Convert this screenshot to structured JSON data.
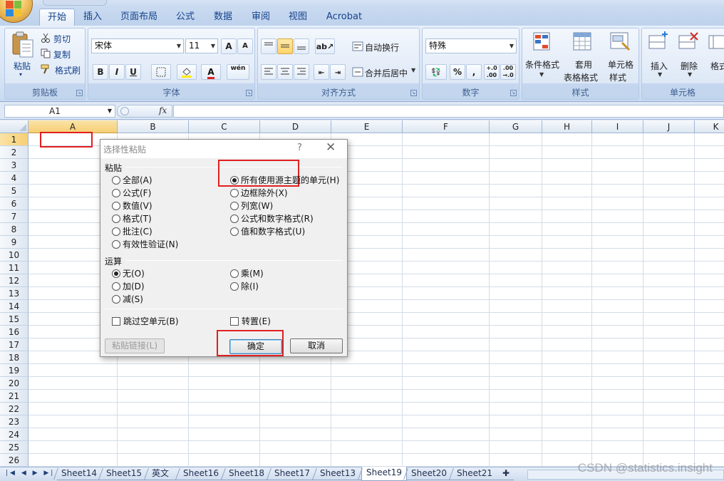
{
  "ribbon": {
    "tabs": [
      "开始",
      "插入",
      "页面布局",
      "公式",
      "数据",
      "审阅",
      "视图",
      "Acrobat"
    ],
    "clipboard": {
      "paste": "粘贴",
      "cut": "剪切",
      "copy": "复制",
      "format_painter": "格式刷",
      "label": "剪贴板"
    },
    "font": {
      "name": "宋体",
      "size": "11",
      "label": "字体",
      "bold": "B",
      "italic": "I",
      "underline": "U",
      "grow": "A",
      "shrink": "A",
      "font_color": "A",
      "phonetic": "wén"
    },
    "alignment": {
      "wrap": "自动换行",
      "merge": "合并后居中",
      "label": "对齐方式"
    },
    "number": {
      "format": "特殊",
      "percent": "%",
      "comma": ",",
      "label": "数字"
    },
    "styles": {
      "conditional": "条件格式",
      "table_1": "套用",
      "table_2": "表格格式",
      "cell_1": "单元格",
      "cell_2": "样式",
      "label": "样式"
    },
    "cells": {
      "insert": "插入",
      "delete": "删除",
      "format": "格式",
      "label": "单元格"
    }
  },
  "formula_bar": {
    "name_box": "A1",
    "fx": "fx",
    "value": ""
  },
  "grid": {
    "columns": [
      "A",
      "B",
      "C",
      "D",
      "E",
      "F",
      "G",
      "H",
      "I",
      "J",
      "K"
    ],
    "rows": [
      "1",
      "2",
      "3",
      "4",
      "5",
      "6",
      "7",
      "8",
      "9",
      "10",
      "11",
      "12",
      "13",
      "14",
      "15",
      "16",
      "17",
      "18",
      "19",
      "20",
      "21",
      "22",
      "23",
      "24",
      "25",
      "26"
    ]
  },
  "sheets": {
    "tabs": [
      "Sheet14",
      "Sheet15",
      "英文",
      "Sheet16",
      "Sheet18",
      "Sheet17",
      "Sheet13",
      "Sheet19",
      "Sheet20",
      "Sheet21"
    ],
    "active": "Sheet19"
  },
  "dialog": {
    "title": "选择性粘贴",
    "help": "?",
    "close": "✕",
    "paste_section": "粘贴",
    "paste_options_left": [
      "全部(A)",
      "公式(F)",
      "数值(V)",
      "格式(T)",
      "批注(C)",
      "有效性验证(N)"
    ],
    "paste_options_right": [
      "所有使用源主题的单元(H)",
      "边框除外(X)",
      "列宽(W)",
      "公式和数字格式(R)",
      "值和数字格式(U)"
    ],
    "paste_selected": "所有使用源主题的单元(H)",
    "operation_section": "运算",
    "operation_left": [
      "无(O)",
      "加(D)",
      "减(S)"
    ],
    "operation_right": [
      "乘(M)",
      "除(I)"
    ],
    "operation_selected": "无(O)",
    "skip_blanks": "跳过空单元(B)",
    "transpose": "转置(E)",
    "paste_link": "粘贴链接(L)",
    "ok": "确定",
    "cancel": "取消"
  },
  "watermark": "CSDN @statistics.insight",
  "colors": {
    "highlight": "#e02020",
    "ribbon_text": "#15428b"
  }
}
